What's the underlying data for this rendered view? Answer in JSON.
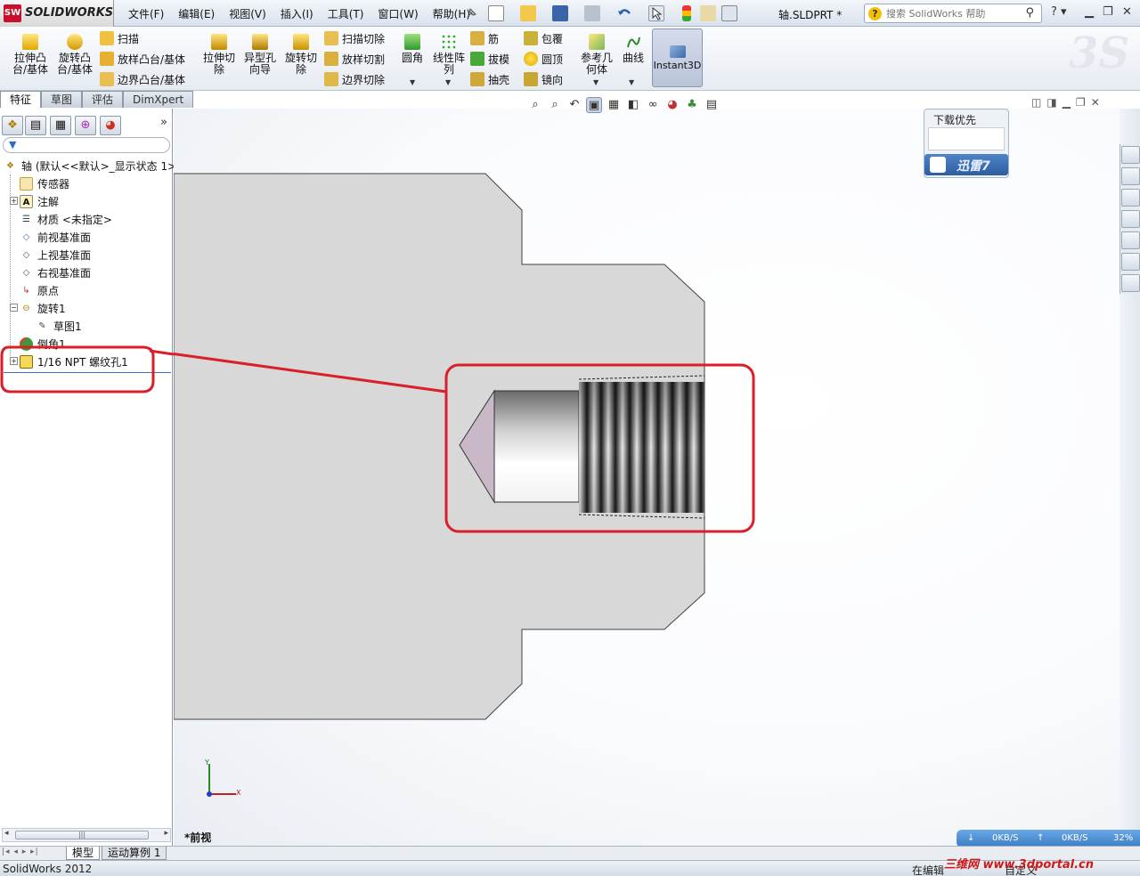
{
  "app": {
    "brand": "SOLIDWORKS",
    "brand_badge": "SW",
    "version_status": "SolidWorks 2012",
    "document_title": "轴.SLDPRT *"
  },
  "menu": [
    "文件(F)",
    "编辑(E)",
    "视图(V)",
    "插入(I)",
    "工具(T)",
    "窗口(W)",
    "帮助(H)"
  ],
  "help_search": {
    "placeholder": "搜索 SolidWorks 帮助"
  },
  "toolbar": {
    "extrude_boss": "拉伸凸\n台/基体",
    "revolve_boss": "旋转凸\n台/基体",
    "sweep": "扫描",
    "loft_boss": "放样凸台/基体",
    "boundary_boss": "边界凸台/基体",
    "extrude_cut": "拉伸切\n除",
    "hole_wizard": "异型孔\n向导",
    "revolve_cut": "旋转切\n除",
    "sweep_cut": "扫描切除",
    "loft_cut": "放样切割",
    "boundary_cut": "边界切除",
    "fillet": "圆角",
    "linear_pattern": "线性阵\n列",
    "rib": "筋",
    "draft": "拔模",
    "shell": "抽壳",
    "wrap": "包覆",
    "dome": "圆顶",
    "mirror": "镜向",
    "ref_geometry": "参考几\n何体",
    "curves": "曲线",
    "instant3d": "Instant3D"
  },
  "tabs": [
    "特征",
    "草图",
    "评估",
    "DimXpert"
  ],
  "active_tab": "特征",
  "feature_tree": {
    "root": "轴 (默认<<默认>_显示状态 1>)",
    "items": [
      {
        "label": "传感器",
        "icon": "sensor-icon"
      },
      {
        "label": "注解",
        "icon": "annotation-icon"
      },
      {
        "label": "材质 <未指定>",
        "icon": "material-icon"
      },
      {
        "label": "前视基准面",
        "icon": "plane-icon"
      },
      {
        "label": "上视基准面",
        "icon": "plane-icon"
      },
      {
        "label": "右视基准面",
        "icon": "plane-icon"
      },
      {
        "label": "原点",
        "icon": "origin-icon"
      },
      {
        "label": "旋转1",
        "icon": "revolve-icon"
      },
      {
        "label": "草图1",
        "icon": "sketch-icon"
      },
      {
        "label": "倒角1",
        "icon": "chamfer-icon"
      },
      {
        "label": "1/16 NPT 螺纹孔1",
        "icon": "hole-icon"
      }
    ]
  },
  "graphics": {
    "view_name": "*前视",
    "triad_y": "Y",
    "triad_x": "X",
    "highlight_color": "#d81f2a",
    "part_fill": "#d8d8d8"
  },
  "download_widget": {
    "title": "下载优先",
    "brand": "迅雷7",
    "down_speed": "0KB/S",
    "up_speed": "0KB/S",
    "percent": "32%"
  },
  "bottom_tabs": [
    "模型",
    "运动算例 1"
  ],
  "status": {
    "left": "SolidWorks 2012",
    "editing": "在编辑",
    "custom": "自定义"
  },
  "watermark": "三维网 www.3dportal.cn"
}
